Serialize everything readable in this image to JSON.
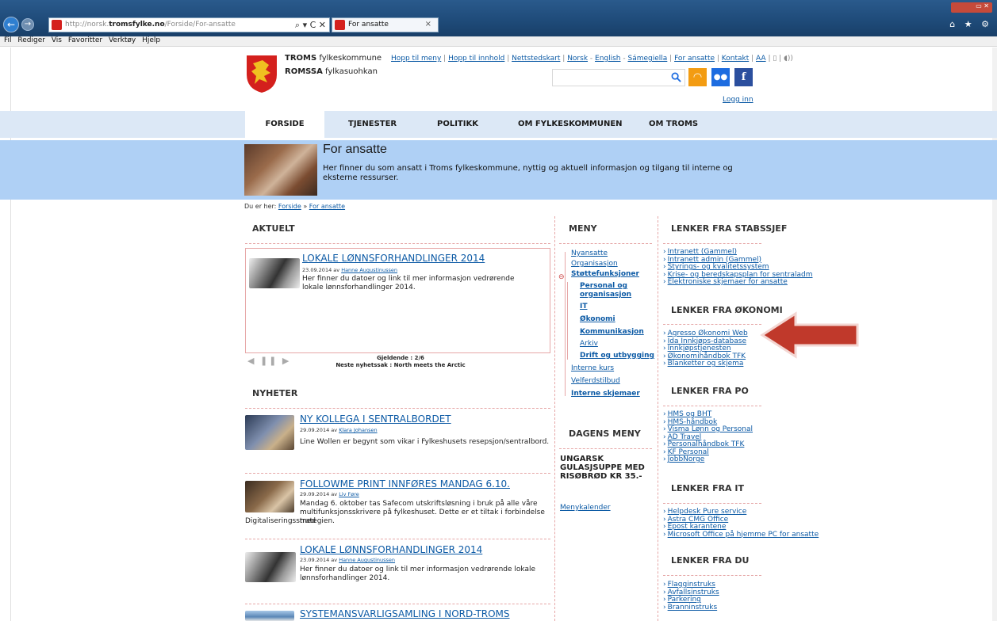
{
  "browser": {
    "url_prefix": "http://norsk.",
    "url_domain": "tromsfylke.no",
    "url_path": "/Forside/For-ansatte",
    "address_controls": "⌕ ▾ C ✕",
    "tab_title": "For ansatte",
    "tab_close": "×",
    "window_controls": "▭ ✕",
    "tool_icons": "⌂ ★ ⚙",
    "menu": [
      "Fil",
      "Rediger",
      "Vis",
      "Favoritter",
      "Verktøy",
      "Hjelp"
    ]
  },
  "header": {
    "brand1_bold": "TROMS",
    "brand1_rest": " fylkeskommune",
    "brand2_bold": "ROMSSA",
    "brand2_rest": " fylkasuohkan",
    "toplinks": [
      "Hopp til meny",
      "Hopp til innhold",
      "Nettstedskart",
      "Norsk",
      "English",
      "Sámegiella",
      "For ansatte",
      "Kontakt",
      "AA"
    ],
    "login": "Logg inn",
    "search_placeholder": ""
  },
  "nav": [
    "FORSIDE",
    "TJENESTER",
    "POLITIKK",
    "OM FYLKESKOMMUNEN",
    "OM TROMS"
  ],
  "banner": {
    "title": "For ansatte",
    "text": "Her finner du som ansatt i Troms fylkeskommune, nyttig og aktuell informasjon og tilgang til interne og eksterne ressurser."
  },
  "breadcrumb": {
    "prefix": "Du er her: ",
    "items": [
      "Forside",
      "For ansatte"
    ],
    "sep": " » "
  },
  "aktuelt": {
    "heading": "AKTUELT",
    "title": "LOKALE LØNNSFORHANDLINGER 2014",
    "date": "23.09.2014 av ",
    "author": "Hanne Augustinussen",
    "text": "Her finner du datoer og link til mer informasjon vedrørende lokale lønnsforhandlinger 2014.",
    "player": "◀ ❚❚ ▶",
    "gjeldende": "Gjeldende : 2/6",
    "neste": "Neste nyhetssak : North meets the Arctic"
  },
  "nyheter": {
    "heading": "NYHETER",
    "items": [
      {
        "title": "NY KOLLEGA I SENTRALBORDET",
        "date": "29.09.2014 av ",
        "author": "Klara Johansen",
        "text": "Line Wollen er begynt som vikar i Fylkeshusets resepsjon/sentralbord."
      },
      {
        "title": "FOLLOWME PRINT INNFØRES MANDAG 6.10.",
        "date": "29.09.2014 av ",
        "author": "Liv Føre",
        "text": "Mandag 6. oktober tas Safecom utskriftsløsning i bruk på alle våre multifunksjonsskrivere på fylkeshuset. Dette er et tiltak i forbindelse med",
        "text2": "Digitaliseringsstrategien."
      },
      {
        "title": "LOKALE LØNNSFORHANDLINGER 2014",
        "date": "23.09.2014 av ",
        "author": "Hanne Augustinussen",
        "text": "Her finner du datoer og link til mer informasjon vedrørende lokale lønnsforhandlinger 2014."
      },
      {
        "title": "SYSTEMANSVARLIGSAMLING I NORD-TROMS"
      }
    ]
  },
  "meny": {
    "heading": "MENY",
    "items": [
      "Nyansatte",
      "Organisasjon",
      "Støttefunksjoner",
      "Personal og",
      "organisasjon",
      "IT",
      "Økonomi",
      "Kommunikasjon",
      "Arkiv",
      "Drift og utbygging",
      "Interne kurs",
      "Velferdstilbud",
      "Interne skjemaer"
    ],
    "minus": "⊖"
  },
  "dagens": {
    "heading": "DAGENS MENY",
    "lines": [
      "UNGARSK",
      "GULASJSUPPE MED",
      "RISØBRØD KR 35.-"
    ],
    "kalender": "Menykalender"
  },
  "right": {
    "stabssjef": {
      "heading": "LENKER FRA STABSSJEF",
      "links": [
        "Intranett (Gammel)",
        "Intranett admin (Gammel)",
        "Styrings- og kvalitetssystem",
        "Krise- og beredskapsplan for sentraladm",
        "Elektroniske skjemaer for ansatte"
      ]
    },
    "okonomi": {
      "heading": "LENKER FRA ØKONOMI",
      "links": [
        "Agresso Økonomi Web",
        "Ida Innkjøps-database",
        "Innkjøpstjenesten",
        "Økonomihåndbok TFK",
        "Blanketter og skjema"
      ]
    },
    "po": {
      "heading": "LENKER FRA PO",
      "links": [
        "HMS og BHT",
        "HMS-håndbok",
        "Visma Lønn og Personal",
        "AD Travel",
        "Personalhåndbok TFK",
        "KF Personal",
        "JobbNorge"
      ]
    },
    "it": {
      "heading": "LENKER FRA IT",
      "links": [
        "Helpdesk Pure service",
        "Astra CMG Office",
        "Epost karantene",
        "Microsoft Office på hjemme PC for ansatte"
      ]
    },
    "du": {
      "heading": "LENKER FRA DU",
      "links": [
        "Flagginstruks",
        "Avfallsinstruks",
        "Parkering",
        "Branninstruks"
      ]
    }
  },
  "colors": {
    "link": "#0c5aa5",
    "nav_bg": "#dce8f6",
    "banner_bg": "#afd0f5",
    "arrow": "#c0392b",
    "separator": "#e6a7a7"
  }
}
